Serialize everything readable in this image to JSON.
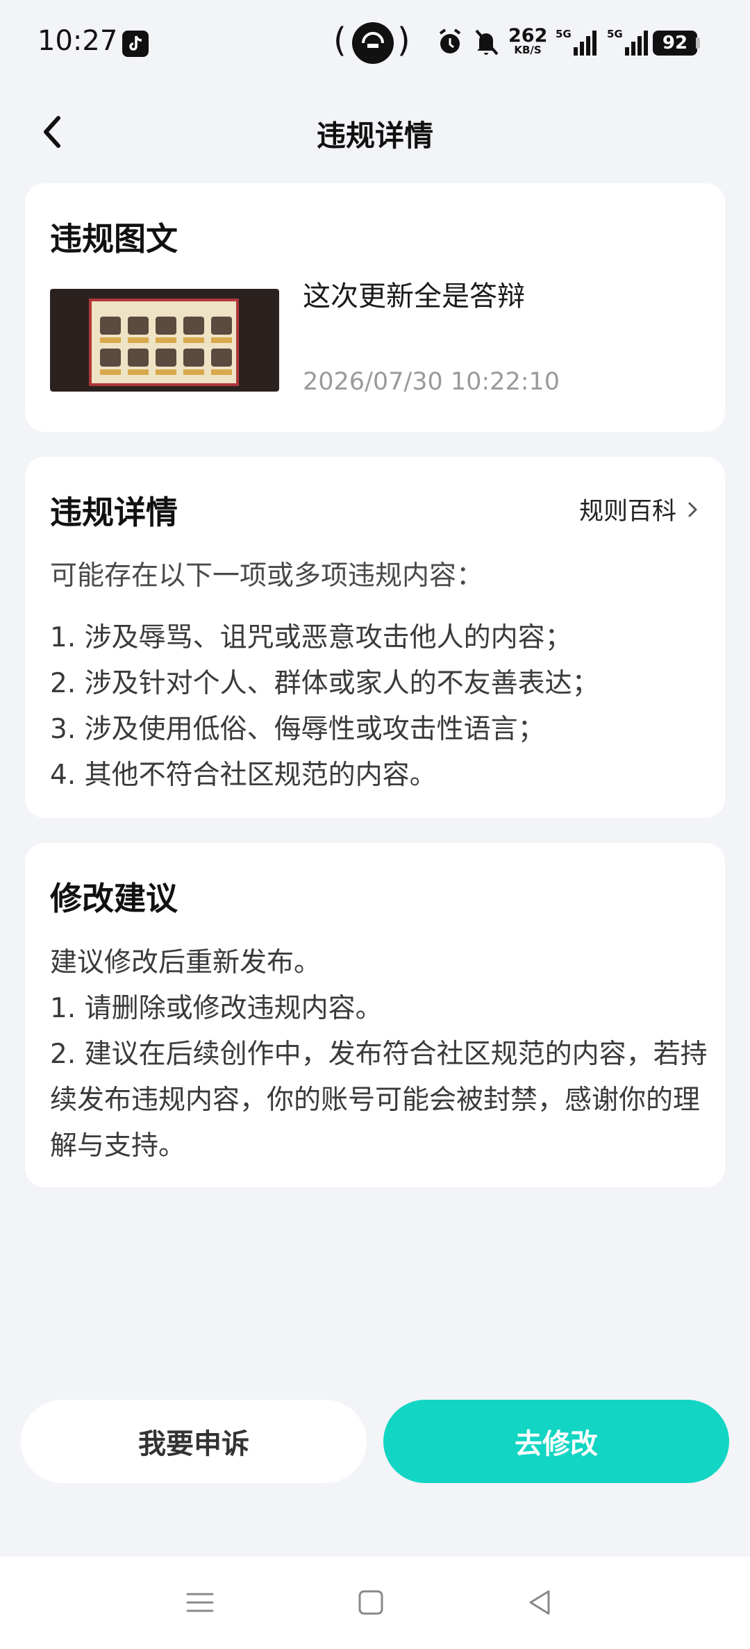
{
  "status_bar": {
    "time": "10:27",
    "net_speed": "262",
    "net_speed_unit": "KB/S",
    "signal1_label": "5G",
    "signal2_label": "5G",
    "battery": "92"
  },
  "header": {
    "title": "违规详情"
  },
  "post_card": {
    "heading": "违规图文",
    "post_title": "这次更新全是答辩",
    "post_time": "2026/07/30 10:22:10"
  },
  "violation_card": {
    "heading": "违规详情",
    "rule_link": "规则百科",
    "intro": "可能存在以下一项或多项违规内容：",
    "items": [
      "1. 涉及辱骂、诅咒或恶意攻击他人的内容；",
      "2. 涉及针对个人、群体或家人的不友善表达；",
      "3. 涉及使用低俗、侮辱性或攻击性语言；",
      "4. 其他不符合社区规范的内容。"
    ]
  },
  "suggestion_card": {
    "heading": "修改建议",
    "lines": [
      "建议修改后重新发布。",
      "1. 请删除或修改违规内容。",
      "2. 建议在后续创作中，发布符合社区规范的内容，若持续发布违规内容，你的账号可能会被封禁，感谢你的理解与支持。"
    ]
  },
  "buttons": {
    "appeal": "我要申诉",
    "edit": "去修改"
  },
  "colors": {
    "accent": "#12d5c3",
    "background": "#f3f4f7"
  }
}
